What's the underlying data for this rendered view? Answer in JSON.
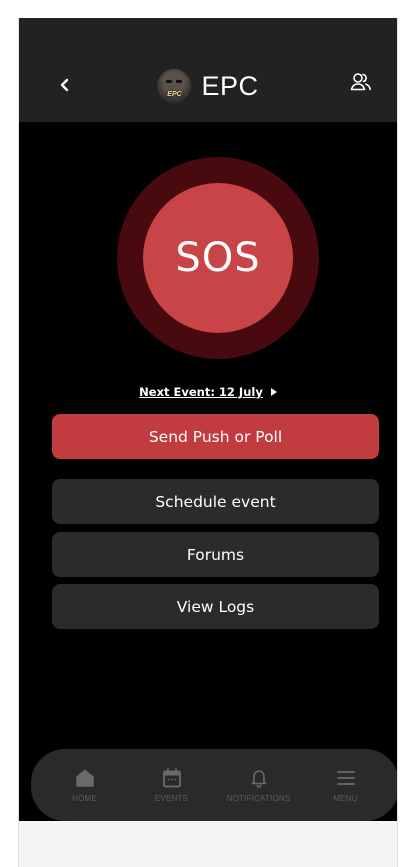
{
  "header": {
    "logo_text": "EPC",
    "brand": "EPC"
  },
  "sos": {
    "label": "SOS"
  },
  "next_event": {
    "label": "Next Event: 12 July"
  },
  "actions": {
    "push_poll": "Send Push or Poll",
    "schedule": "Schedule event",
    "forums": "Forums",
    "logs": "View Logs"
  },
  "tabbar": {
    "items": [
      {
        "label": "HOME",
        "icon": "home-icon"
      },
      {
        "label": "EVENTS",
        "icon": "calendar-icon"
      },
      {
        "label": "NOTIFICATIONS",
        "icon": "bell-icon"
      },
      {
        "label": "MENU",
        "icon": "hamburger-icon"
      }
    ]
  },
  "colors": {
    "accent": "#c23b3e",
    "sos_fill": "#c84447",
    "sos_ring": "#480a0e",
    "background": "#000000",
    "header": "#222223",
    "button": "#2b2b2c"
  }
}
